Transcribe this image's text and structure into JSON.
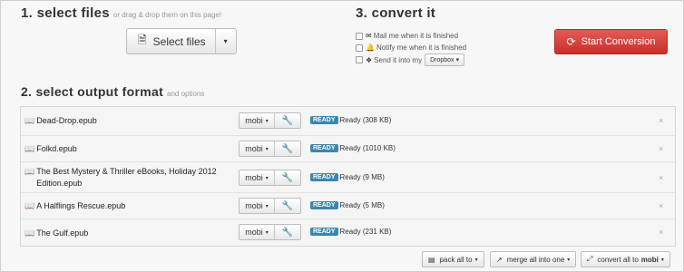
{
  "section1": {
    "title": "1. select files",
    "hint": "or drag & drop them on this page!",
    "select_button": {
      "label": "Select files",
      "icon": "file-icon",
      "caret": "▾"
    }
  },
  "section3": {
    "title": "3. convert it",
    "options": [
      {
        "label": "Mail me when it is finished",
        "icon": "envelope-icon",
        "checked": false
      },
      {
        "label": "Notify me when it is finished",
        "icon": "bell-icon",
        "checked": false
      },
      {
        "label": "Send it into my",
        "icon": "dropbox-icon",
        "checked": false,
        "dropdown": "Dropbox",
        "caret": "▾"
      }
    ],
    "start_button": {
      "label": "Start Conversion",
      "icon": "refresh-icon"
    }
  },
  "section2": {
    "title": "2. select output format",
    "hint": "and options",
    "files": [
      {
        "name": "Dead-Drop.epub",
        "format": "mobi",
        "badge": "READY",
        "status": "Ready (308 KB)"
      },
      {
        "name": "Folkd.epub",
        "format": "mobi",
        "badge": "READY",
        "status": "Ready (1010 KB)"
      },
      {
        "name": "The Best Mystery & Thriller eBooks, Holiday 2012 Edition.epub",
        "format": "mobi",
        "badge": "READY",
        "status": "Ready (9 MB)"
      },
      {
        "name": "A Halflings Rescue.epub",
        "format": "mobi",
        "badge": "READY",
        "status": "Ready (5 MB)"
      },
      {
        "name": "The Gulf.epub",
        "format": "mobi",
        "badge": "READY",
        "status": "Ready (231 KB)"
      }
    ],
    "remove_glyph": "×",
    "caret": "▾"
  },
  "toolbar": {
    "pack_all": "pack all to",
    "merge_all": "merge all into one",
    "convert_all": "convert all to",
    "convert_all_format": "mobi",
    "caret": "▾"
  },
  "colors": {
    "start_button": "#d9534f",
    "ready_badge": "#3a87ad"
  }
}
